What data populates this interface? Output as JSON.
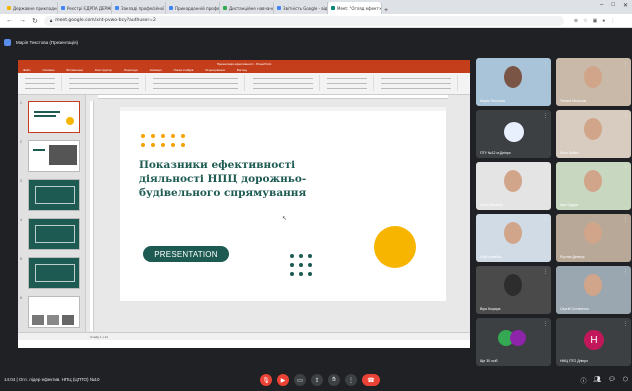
{
  "browser": {
    "tabs": [
      {
        "title": "Державне прикладного",
        "color": "#f4b400",
        "active": false
      },
      {
        "title": "Реєстрі ЄДРПА ДЕРЖ",
        "color": "#4285f4",
        "active": false
      },
      {
        "title": "Закладі професійної о",
        "color": "#4285f4",
        "active": false
      },
      {
        "title": "Прикордонній професі",
        "color": "#4285f4",
        "active": false
      },
      {
        "title": "Дистанційне навчання",
        "color": "#34a853",
        "active": false
      },
      {
        "title": "Звітність Google - відо",
        "color": "#4285f4",
        "active": false
      },
      {
        "title": "Meet: \"Огляд ефект",
        "color": "#00897b",
        "active": true
      }
    ],
    "url": "meet.google.com/xnt-pvwo-bcy?authuser=2"
  },
  "meet": {
    "presenter": "Марія Текстова (Презентація)",
    "meeting_info": "14:04 | Огл. лідер ефектив. НПЦ (ЦПТО) №10"
  },
  "ppt": {
    "window_title": "Презентація ефективності - PowerPoint",
    "menu": [
      "Файл",
      "Основне",
      "Вставлення",
      "Конструктор",
      "Переходи",
      "Анімація",
      "Показ слайдів",
      "Рецензування",
      "Вигляд"
    ],
    "status": "Слайд 1 з 12"
  },
  "slide": {
    "title": "Показники ефективності діяльності НПЦ дорожньо-будівельного спрямування",
    "button": "PRESENTATION",
    "accent": "#f7b500",
    "primary": "#1d5a52"
  },
  "participants": [
    {
      "name": "Марія Текстова",
      "kind": "video"
    },
    {
      "name": "Тетяна Мельник",
      "kind": "video"
    },
    {
      "name": "ПТУ №12 м.Дніпро",
      "kind": "avatar"
    },
    {
      "name": "Леся Бойко",
      "kind": "video"
    },
    {
      "name": "Юлія Балаєва",
      "kind": "video"
    },
    {
      "name": "Іван Ордов",
      "kind": "video"
    },
    {
      "name": "НЦВ Кривбас",
      "kind": "video"
    },
    {
      "name": "Руслан Демчук",
      "kind": "video"
    },
    {
      "name": "Віра Коцюра",
      "kind": "video"
    },
    {
      "name": "Сергій Остапенко",
      "kind": "video"
    },
    {
      "name": "Ще 30 осіб",
      "kind": "more"
    },
    {
      "name": "НМЦ ПТО Дніпро",
      "kind": "letter",
      "letter": "Н"
    }
  ],
  "icons": [
    "mic-icon",
    "camera-icon",
    "captions-icon",
    "present-icon",
    "raise-hand-icon",
    "more-icon",
    "hangup-icon",
    "info-icon",
    "people-icon",
    "chat-icon"
  ]
}
